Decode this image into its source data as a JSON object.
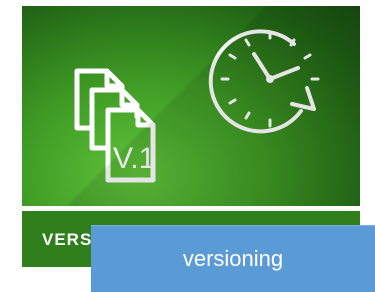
{
  "tile": {
    "version_badge": "V.1",
    "icons": [
      "documents-icon",
      "clock-history-icon"
    ],
    "footer_label": "VERS"
  },
  "tooltip": {
    "label": "versioning"
  },
  "colors": {
    "tile_green_dark": "#174d10",
    "tile_green_light": "#5fc53a",
    "footer_green": "#2f7f1c",
    "tooltip_blue": "#5b9bd5",
    "icon_white": "#ffffff"
  }
}
